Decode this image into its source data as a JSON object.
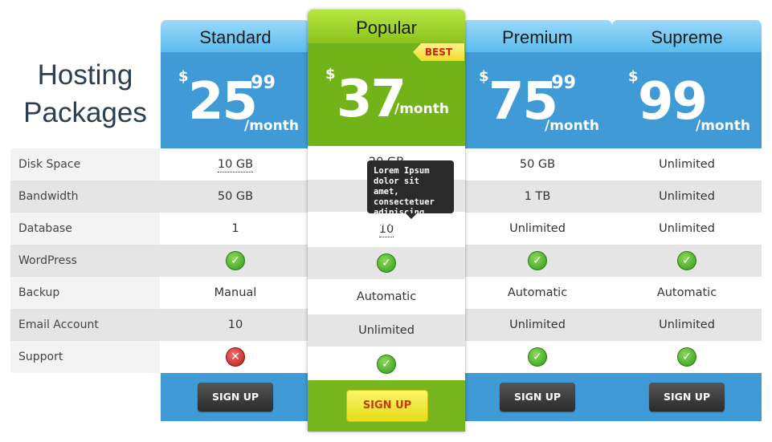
{
  "title_line1": "Hosting",
  "title_line2": "Packages",
  "features": [
    "Disk Space",
    "Bandwidth",
    "Database",
    "WordPress",
    "Backup",
    "Email Account",
    "Support"
  ],
  "plans": [
    {
      "name": "Standard",
      "currency": "$",
      "amount": "25",
      "cents": ".99",
      "period": "/month",
      "values": [
        "10 GB",
        "50 GB",
        "1",
        "check",
        "Manual",
        "10",
        "cross"
      ],
      "button": "SIGN UP"
    },
    {
      "name": "Popular",
      "currency": "$",
      "amount": "37",
      "cents": "",
      "period": "/month",
      "values": [
        "20 GB",
        "",
        "10",
        "check",
        "Automatic",
        "Unlimited",
        "check"
      ],
      "button": "SIGN UP",
      "badge": "BEST"
    },
    {
      "name": "Premium",
      "currency": "$",
      "amount": "75",
      "cents": ".99",
      "period": "/month",
      "values": [
        "50 GB",
        "1 TB",
        "Unlimited",
        "check",
        "Automatic",
        "Unlimited",
        "check"
      ],
      "button": "SIGN UP"
    },
    {
      "name": "Supreme",
      "currency": "$",
      "amount": "99",
      "cents": "",
      "period": "/month",
      "values": [
        "Unlimited",
        "Unlimited",
        "Unlimited",
        "check",
        "Automatic",
        "Unlimited",
        "check"
      ],
      "button": "SIGN UP"
    }
  ],
  "tooltip": "Lorem Ipsum dolor sit amet, consectetuer adipiscing elit.",
  "colors": {
    "blue": "#3f9ad6",
    "green": "#76b51d",
    "dark_button": "#2b2b2b",
    "yellow_button": "#f1e824"
  }
}
